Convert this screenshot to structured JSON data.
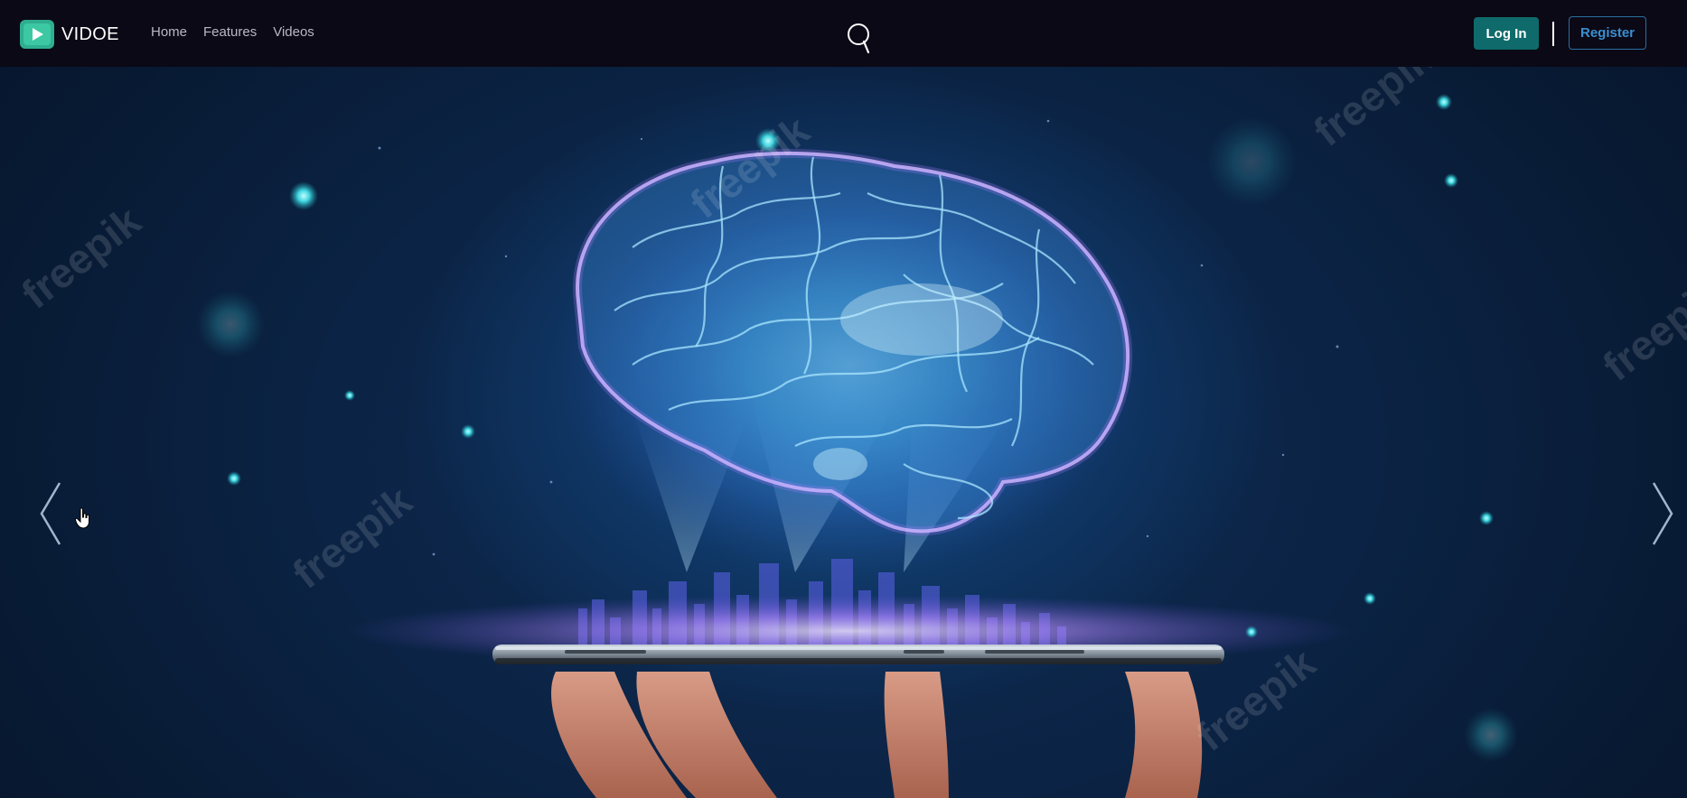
{
  "brand": {
    "name": "VIDOE",
    "logo_icon": "play-icon",
    "accent_color": "#2fae8f"
  },
  "nav": {
    "items": [
      {
        "label": "Home"
      },
      {
        "label": "Features"
      },
      {
        "label": "Videos"
      }
    ]
  },
  "search": {
    "icon": "search-icon"
  },
  "auth": {
    "login_label": "Log In",
    "register_label": "Register",
    "login_color": "#0f6b6b",
    "register_color": "#3a8fd0"
  },
  "hero": {
    "image": "glowing-brain-hologram-over-smartphone",
    "watermark": "freepik",
    "prev_icon": "chevron-left-icon",
    "next_icon": "chevron-right-icon"
  }
}
